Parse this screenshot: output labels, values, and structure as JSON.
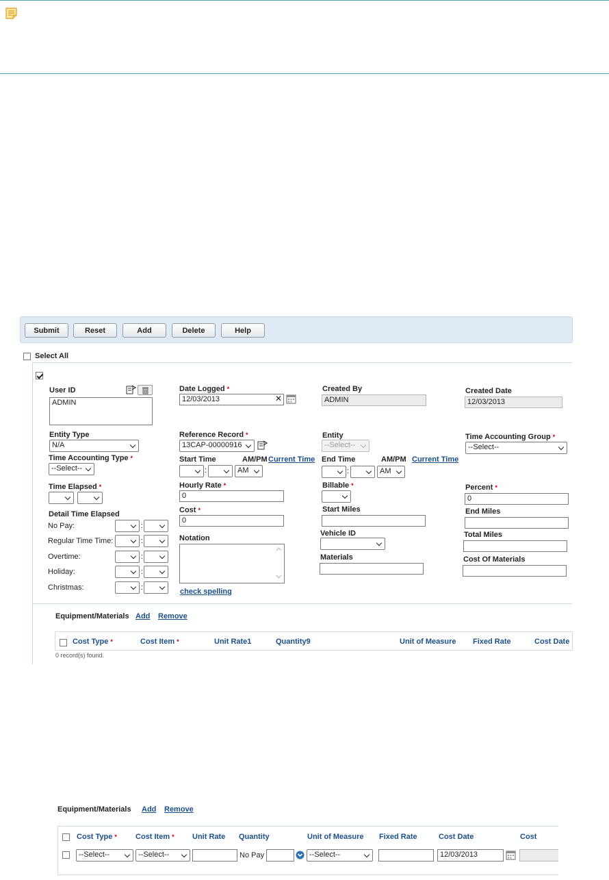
{
  "note": {
    "icon": "note-icon"
  },
  "toolbar": {
    "buttons": [
      "Submit",
      "Reset",
      "Add",
      "Delete",
      "Help"
    ]
  },
  "form": {
    "select_all_label": "Select All",
    "user_id": {
      "label": "User ID",
      "value": "ADMIN"
    },
    "date_logged": {
      "label": "Date Logged",
      "value": "12/03/2013"
    },
    "created_by": {
      "label": "Created By",
      "value": "ADMIN"
    },
    "created_date": {
      "label": "Created Date",
      "value": "12/03/2013"
    },
    "entity_type": {
      "label": "Entity Type",
      "value": "N/A"
    },
    "reference_record": {
      "label": "Reference Record",
      "value": "13CAP-00000916"
    },
    "entity": {
      "label": "Entity",
      "value": "--Select--"
    },
    "time_accounting_group": {
      "label": "Time Accounting Group",
      "value": "--Select--"
    },
    "time_accounting_type": {
      "label": "Time Accounting Type",
      "value": "--Select--"
    },
    "start_time": {
      "label": "Start Time",
      "ampm_label": "AM/PM",
      "ampm": "AM",
      "current_time": "Current Time"
    },
    "end_time": {
      "label": "End Time",
      "ampm_label": "AM/PM",
      "ampm": "AM",
      "current_time": "Current Time"
    },
    "time_elapsed": {
      "label": "Time Elapsed"
    },
    "hourly_rate": {
      "label": "Hourly Rate",
      "value": "0"
    },
    "billable": {
      "label": "Billable"
    },
    "percent": {
      "label": "Percent",
      "value": "0"
    },
    "detail_time_elapsed": {
      "label": "Detail Time Elapsed",
      "rows": [
        "No Pay:",
        "Regular Time Time:",
        "Overtime:",
        "Holiday:",
        "Christmas:"
      ]
    },
    "cost": {
      "label": "Cost",
      "value": "0"
    },
    "start_miles": {
      "label": "Start Miles"
    },
    "end_miles": {
      "label": "End Miles"
    },
    "notation": {
      "label": "Notation"
    },
    "check_spelling": "check spelling",
    "vehicle_id": {
      "label": "Vehicle ID"
    },
    "total_miles": {
      "label": "Total Miles"
    },
    "materials": {
      "label": "Materials"
    },
    "cost_of_materials": {
      "label": "Cost Of Materials"
    },
    "required_mark": "*"
  },
  "equipment1": {
    "title": "Equipment/Materials",
    "add": "Add",
    "remove": "Remove",
    "columns": [
      "Cost Type",
      "Cost Item",
      "Unit Rate1",
      "Quantity9",
      "Unit of Measure",
      "Fixed Rate",
      "Cost Date"
    ],
    "records_found": "0 record(s) found."
  },
  "equipment2": {
    "title": "Equipment/Materials",
    "add": "Add",
    "remove": "Remove",
    "columns": [
      "Cost Type",
      "Cost Item",
      "Unit Rate",
      "Quantity",
      "Unit of Measure",
      "Fixed Rate",
      "Cost Date",
      "Cost"
    ],
    "row": {
      "cost_type": "--Select--",
      "cost_item": "--Select--",
      "quantity_prefix": "No Pay",
      "unit_of_measure": "--Select--",
      "cost_date": "12/03/2013"
    }
  }
}
